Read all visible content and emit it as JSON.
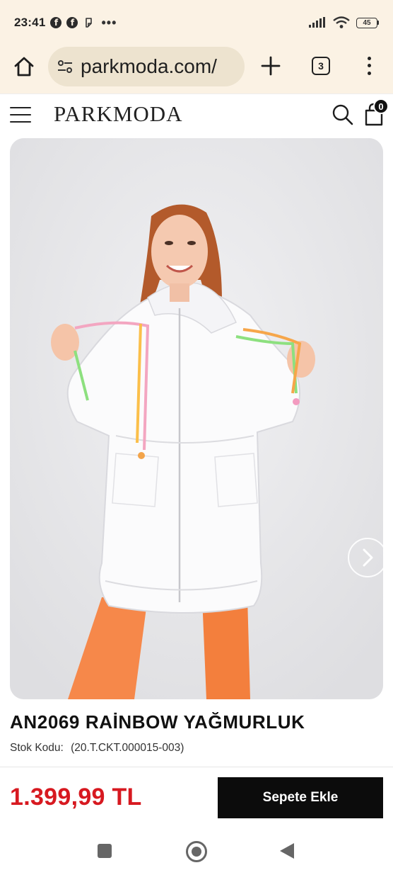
{
  "status_bar": {
    "time": "23:41",
    "battery": "45",
    "more": "•••",
    "notification_icons": [
      "facebook-icon",
      "facebook-icon",
      "sticker-icon"
    ],
    "system_icons": [
      "signal-icon",
      "wifi-icon",
      "battery-icon"
    ]
  },
  "browser": {
    "url": "parkmoda.com/",
    "tab_count": "3",
    "icons": [
      "home-icon",
      "site-settings-icon",
      "new-tab-icon",
      "tabs-icon",
      "menu-icon"
    ]
  },
  "site_header": {
    "logo": "PARKMODA",
    "cart_count": "0",
    "icons": [
      "hamburger-icon",
      "search-icon",
      "cart-icon"
    ]
  },
  "product": {
    "title": "AN2069 RAİNBOW YAĞMURLUK",
    "stock_label": "Stok Kodu:",
    "stock_code": "(20.T.CKT.000015-003)",
    "price": "1.399,99 TL",
    "add_to_cart": "Sepete Ekle",
    "gallery_icon": "chevron-right-icon"
  },
  "colors": {
    "chrome_bg": "#fbf2e4",
    "url_bg": "#ede3cf",
    "price": "#d71920",
    "button_bg": "#0c0c0c"
  },
  "nav_bar": {
    "icons": [
      "recents-icon",
      "home-circle-icon",
      "back-icon"
    ]
  }
}
